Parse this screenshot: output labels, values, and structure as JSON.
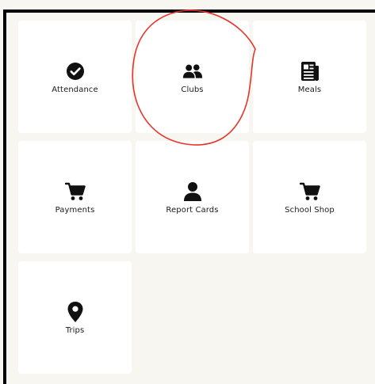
{
  "tiles": [
    {
      "label": "Attendance",
      "icon": "check-circle-icon"
    },
    {
      "label": "Clubs",
      "icon": "people-icon"
    },
    {
      "label": "Meals",
      "icon": "newspaper-icon"
    },
    {
      "label": "Payments",
      "icon": "shopping-cart-icon"
    },
    {
      "label": "Report Cards",
      "icon": "person-icon"
    },
    {
      "label": "School Shop",
      "icon": "shopping-cart-icon"
    },
    {
      "label": "Trips",
      "icon": "map-marker-icon"
    }
  ],
  "colors": {
    "background": "#f7f6f1",
    "tile": "#ffffff",
    "icon": "#111111",
    "annotation": "#e8332a"
  }
}
